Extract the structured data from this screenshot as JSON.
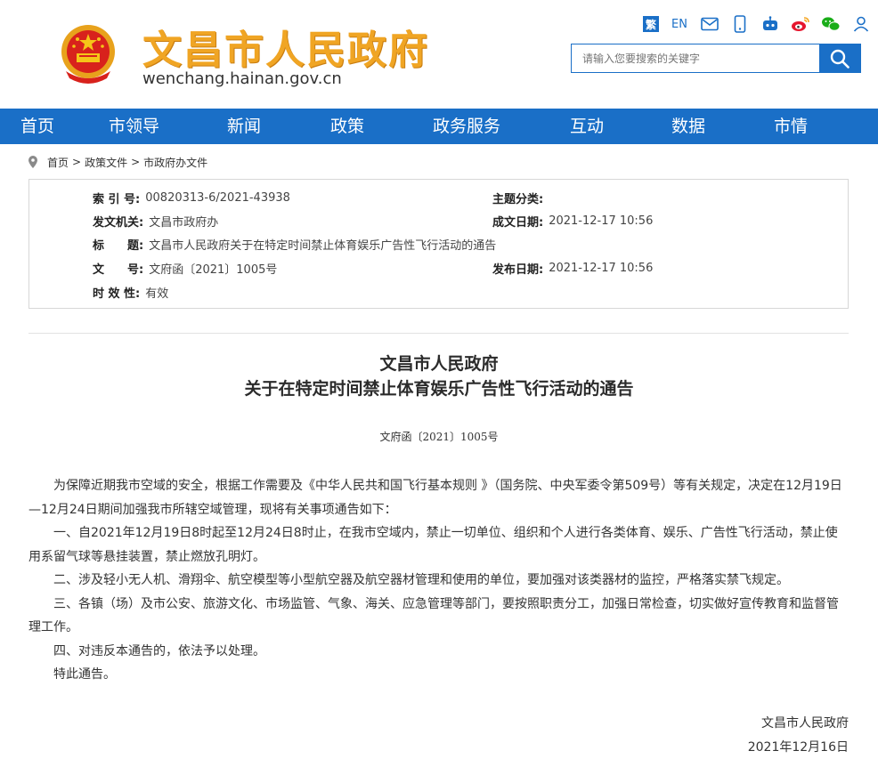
{
  "header": {
    "site_title": "文昌市人民政府",
    "site_domain": "wenchang.hainan.gov.cn",
    "tools": {
      "fan": "繁",
      "en": "EN"
    },
    "search_placeholder": "请输入您要搜索的关键字"
  },
  "nav": [
    "首页",
    "市领导",
    "新闻",
    "政策",
    "政务服务",
    "互动",
    "数据",
    "市情"
  ],
  "breadcrumb": [
    "首页",
    "政策文件",
    "市政府办文件"
  ],
  "breadcrumb_sep": ">",
  "info": {
    "index_label": "索 引 号:",
    "index_value": "00820313-6/2021-43938",
    "topic_label": "主题分类:",
    "topic_value": "",
    "issuer_label": "发文机关:",
    "issuer_value": "文昌市政府办",
    "created_label": "成文日期:",
    "created_value": "2021-12-17 10:56",
    "title_label": "标　　题:",
    "title_value": "文昌市人民政府关于在特定时间禁止体育娱乐广告性飞行活动的通告",
    "docno_label": "文　　号:",
    "docno_value": "文府函〔2021〕1005号",
    "published_label": "发布日期:",
    "published_value": "2021-12-17 10:56",
    "validity_label": "时 效 性:",
    "validity_value": "有效"
  },
  "doc": {
    "title_line1": "文昌市人民政府",
    "title_line2": "关于在特定时间禁止体育娱乐广告性飞行活动的通告",
    "doc_number": "文府函〔2021〕1005号",
    "paragraphs": [
      "为保障近期我市空域的安全，根据工作需要及《中华人民共和国飞行基本规则 》（国务院、中央军委令第509号）等有关规定，决定在12月19日—12月24日期间加强我市所辖空域管理，现将有关事项通告如下：",
      "一、自2021年12月19日8时起至12月24日8时止，在我市空域内，禁止一切单位、组织和个人进行各类体育、娱乐、广告性飞行活动，禁止使用系留气球等悬挂装置，禁止燃放孔明灯。",
      "二、涉及轻小无人机、滑翔伞、航空模型等小型航空器及航空器材管理和使用的单位，要加强对该类器材的监控，严格落实禁飞规定。",
      "三、各镇（场）及市公安、旅游文化、市场监管、气象、海关、应急管理等部门，要按照职责分工，加强日常检查，切实做好宣传教育和监督管理工作。",
      "四、对违反本通告的，依法予以处理。",
      "特此通告。"
    ],
    "signature": "文昌市人民政府",
    "date": "2021年12月16日"
  },
  "colors": {
    "brand_blue": "#1a6fc7",
    "title_gold": "#f0a524"
  }
}
